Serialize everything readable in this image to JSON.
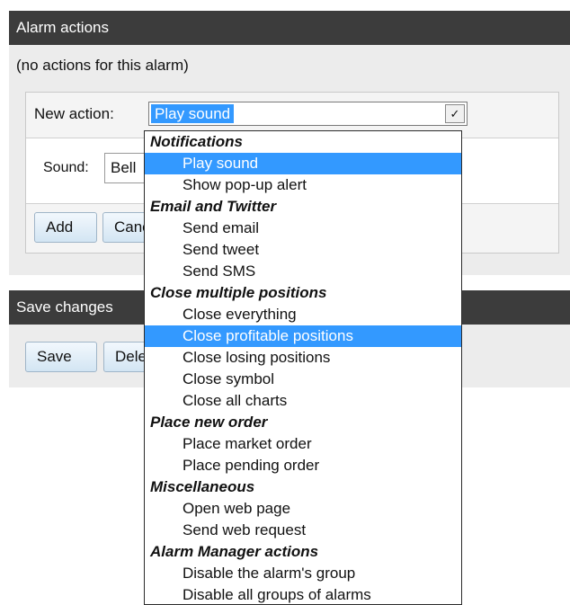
{
  "alarm_actions_panel": {
    "title": "Alarm actions",
    "no_actions_text": "(no actions for this alarm)",
    "new_action_label": "New action:",
    "new_action_value": "Play sound",
    "sound_label": "Sound:",
    "sound_value": "Bell",
    "add_button": "Add",
    "cancel_button": "Cancel"
  },
  "save_panel": {
    "title": "Save changes",
    "save_button": "Save",
    "delete_button": "Delete"
  },
  "dropdown": {
    "selected_color": "#3399ff",
    "groups": [
      {
        "label": "Notifications",
        "items": [
          {
            "label": "Play sound",
            "selected": true
          },
          {
            "label": "Show pop-up alert"
          }
        ]
      },
      {
        "label": "Email and Twitter",
        "items": [
          {
            "label": "Send email"
          },
          {
            "label": "Send tweet"
          },
          {
            "label": "Send SMS"
          }
        ]
      },
      {
        "label": "Close multiple positions",
        "items": [
          {
            "label": "Close everything"
          },
          {
            "label": "Close profitable positions",
            "selected": true
          },
          {
            "label": "Close losing positions"
          },
          {
            "label": "Close symbol"
          },
          {
            "label": "Close all charts"
          }
        ]
      },
      {
        "label": "Place new order",
        "items": [
          {
            "label": "Place market order"
          },
          {
            "label": "Place pending order"
          }
        ]
      },
      {
        "label": "Miscellaneous",
        "items": [
          {
            "label": "Open web page"
          },
          {
            "label": "Send web request"
          }
        ]
      },
      {
        "label": "Alarm Manager actions",
        "items": [
          {
            "label": "Disable the alarm's group"
          },
          {
            "label": "Disable all groups of alarms"
          }
        ]
      }
    ]
  }
}
